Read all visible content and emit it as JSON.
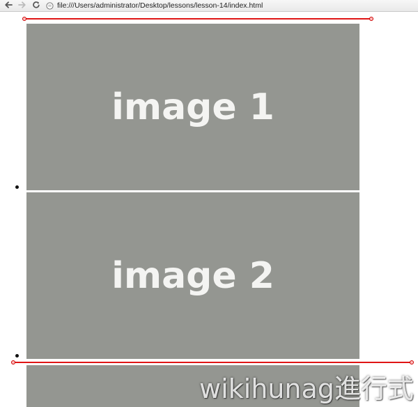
{
  "browser": {
    "url": "file:///Users/administrator/Desktop/lessons/lesson-14/index.html",
    "back_icon": "back-arrow-icon",
    "forward_icon": "forward-arrow-icon",
    "reload_icon": "reload-icon",
    "page_icon": "file-page-icon"
  },
  "page": {
    "list_items": [
      {
        "label": "image 1"
      },
      {
        "label": "image 2"
      },
      {
        "label": ""
      }
    ]
  },
  "watermark": {
    "text": "wikihunag進行式"
  },
  "colors": {
    "placeholder_bg": "#949691",
    "placeholder_text": "#f4f4f2",
    "measure_line": "#e01515"
  }
}
